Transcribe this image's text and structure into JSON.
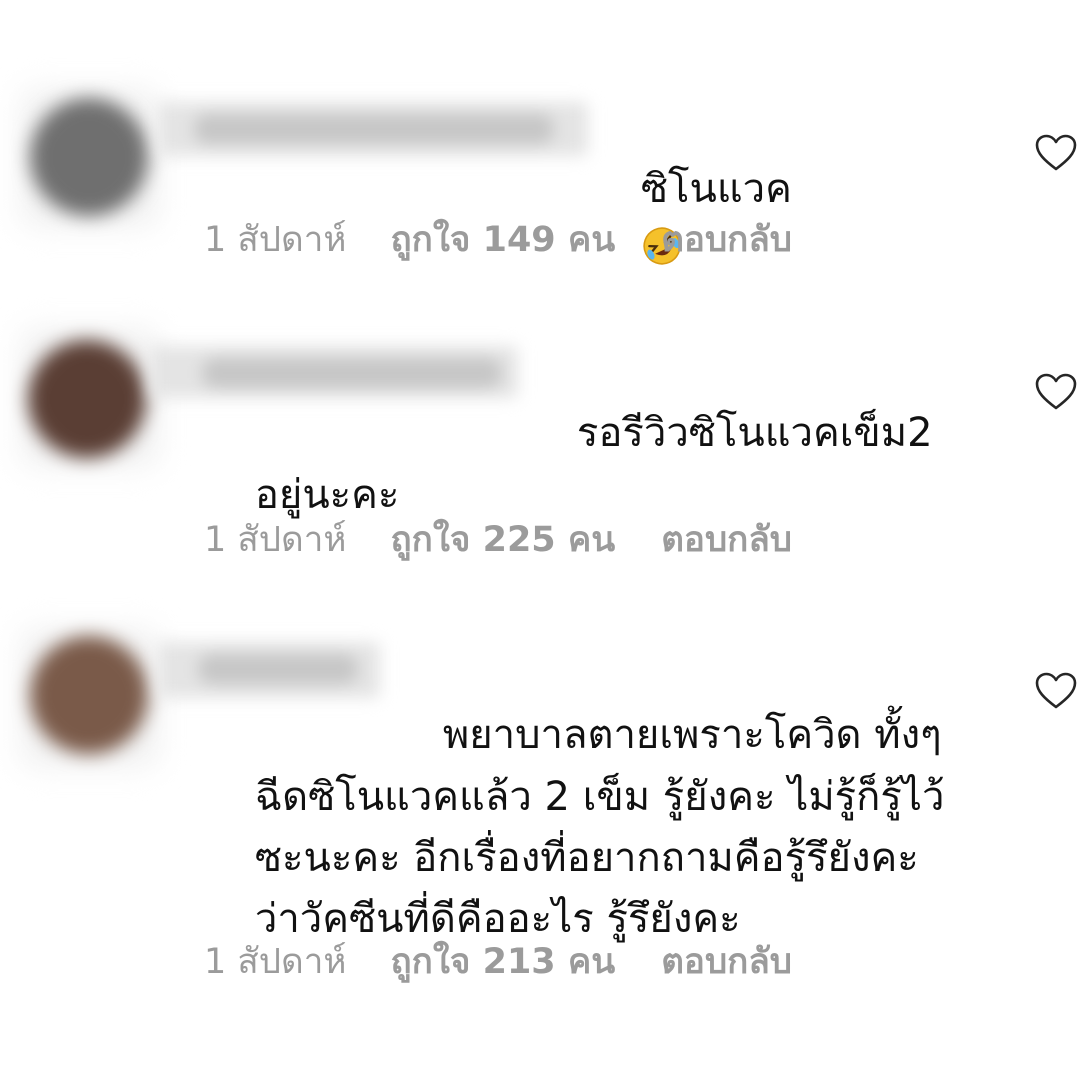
{
  "comments": [
    {
      "text": "ซิโนแวค",
      "emoji": "rolling-on-floor-laughing",
      "time": "1 สัปดาห์",
      "likes": "ถูกใจ 149 คน",
      "reply": "ตอบกลับ",
      "avatar_color": "#6f6f6f"
    },
    {
      "text_line1": "รอรีวิวซิโนแวคเข็ม2",
      "text_line2": "อยู่นะคะ",
      "time": "1 สัปดาห์",
      "likes": "ถูกใจ 225 คน",
      "reply": "ตอบกลับ",
      "avatar_color": "#5a3e34"
    },
    {
      "text_line1": "พยาบาลตายเพราะโควิด ทั้งๆ",
      "text_line2": "ฉีดซิโนแวคแล้ว 2 เข็ม รู้ยังคะ ไม่รู้ก็รู้ไว้",
      "text_line3": "ซะนะคะ อีกเรื่องที่อยากถามคือรู้รึยังคะ",
      "text_line4": "ว่าวัคซีนที่ดีคืออะไร รู้รึยังคะ",
      "time": "1 สัปดาห์",
      "likes": "ถูกใจ 213 คน",
      "reply": "ตอบกลับ",
      "avatar_color": "#7a5a49"
    }
  ],
  "icons": {
    "like": "heart-outline-icon"
  }
}
